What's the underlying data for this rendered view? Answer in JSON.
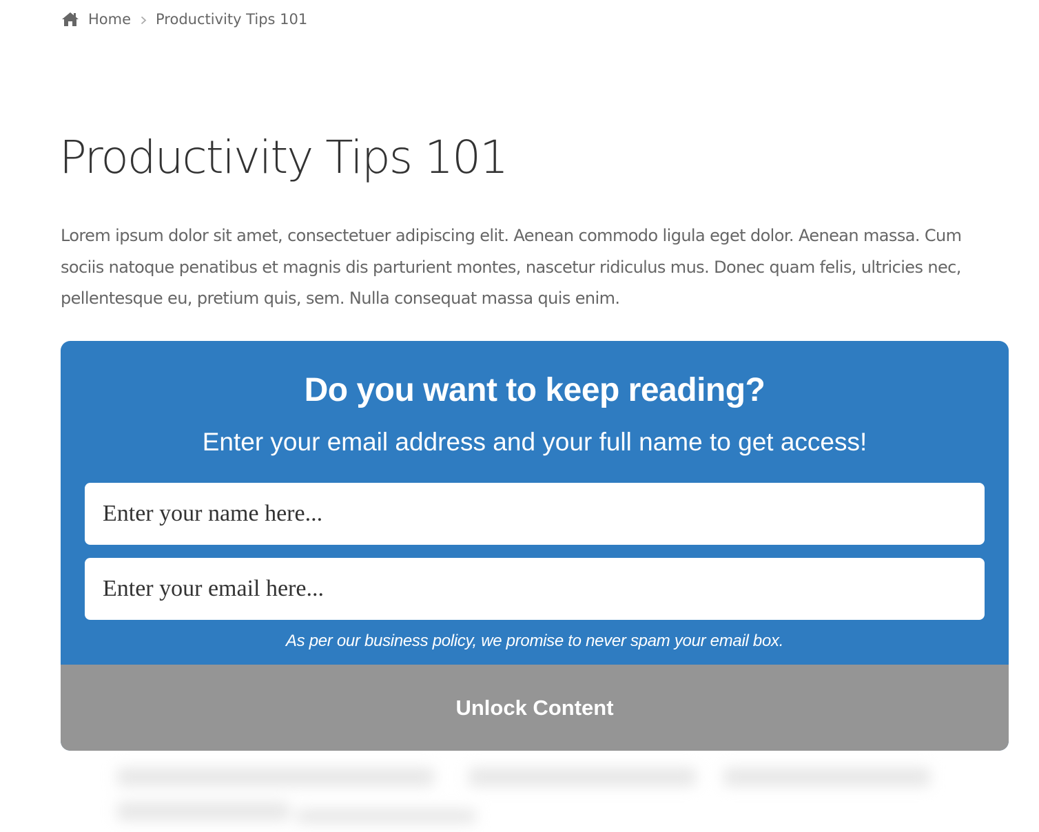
{
  "breadcrumb": {
    "home_icon": "home-icon",
    "home_label": "Home",
    "separator_icon": "chevron-right-icon",
    "current": "Productivity Tips 101"
  },
  "page": {
    "title": "Productivity Tips 101",
    "intro": "Lorem ipsum dolor sit amet, consectetuer adipiscing elit. Aenean commodo ligula eget dolor. Aenean massa. Cum sociis natoque penatibus et magnis dis parturient montes, nascetur ridiculus mus. Donec quam felis, ultricies nec, pellentesque eu, pretium quis, sem. Nulla consequat massa quis enim."
  },
  "optin": {
    "heading": "Do you want to keep reading?",
    "subheading": "Enter your email address and your full name to get access!",
    "name_placeholder": "Enter your name here...",
    "email_placeholder": "Enter your email here...",
    "policy": "As per our business policy, we promise to never spam your email box.",
    "button_label": "Unlock Content"
  },
  "colors": {
    "optin_background": "#2f7cc1",
    "button_background": "#959595",
    "text_muted": "#666666"
  }
}
